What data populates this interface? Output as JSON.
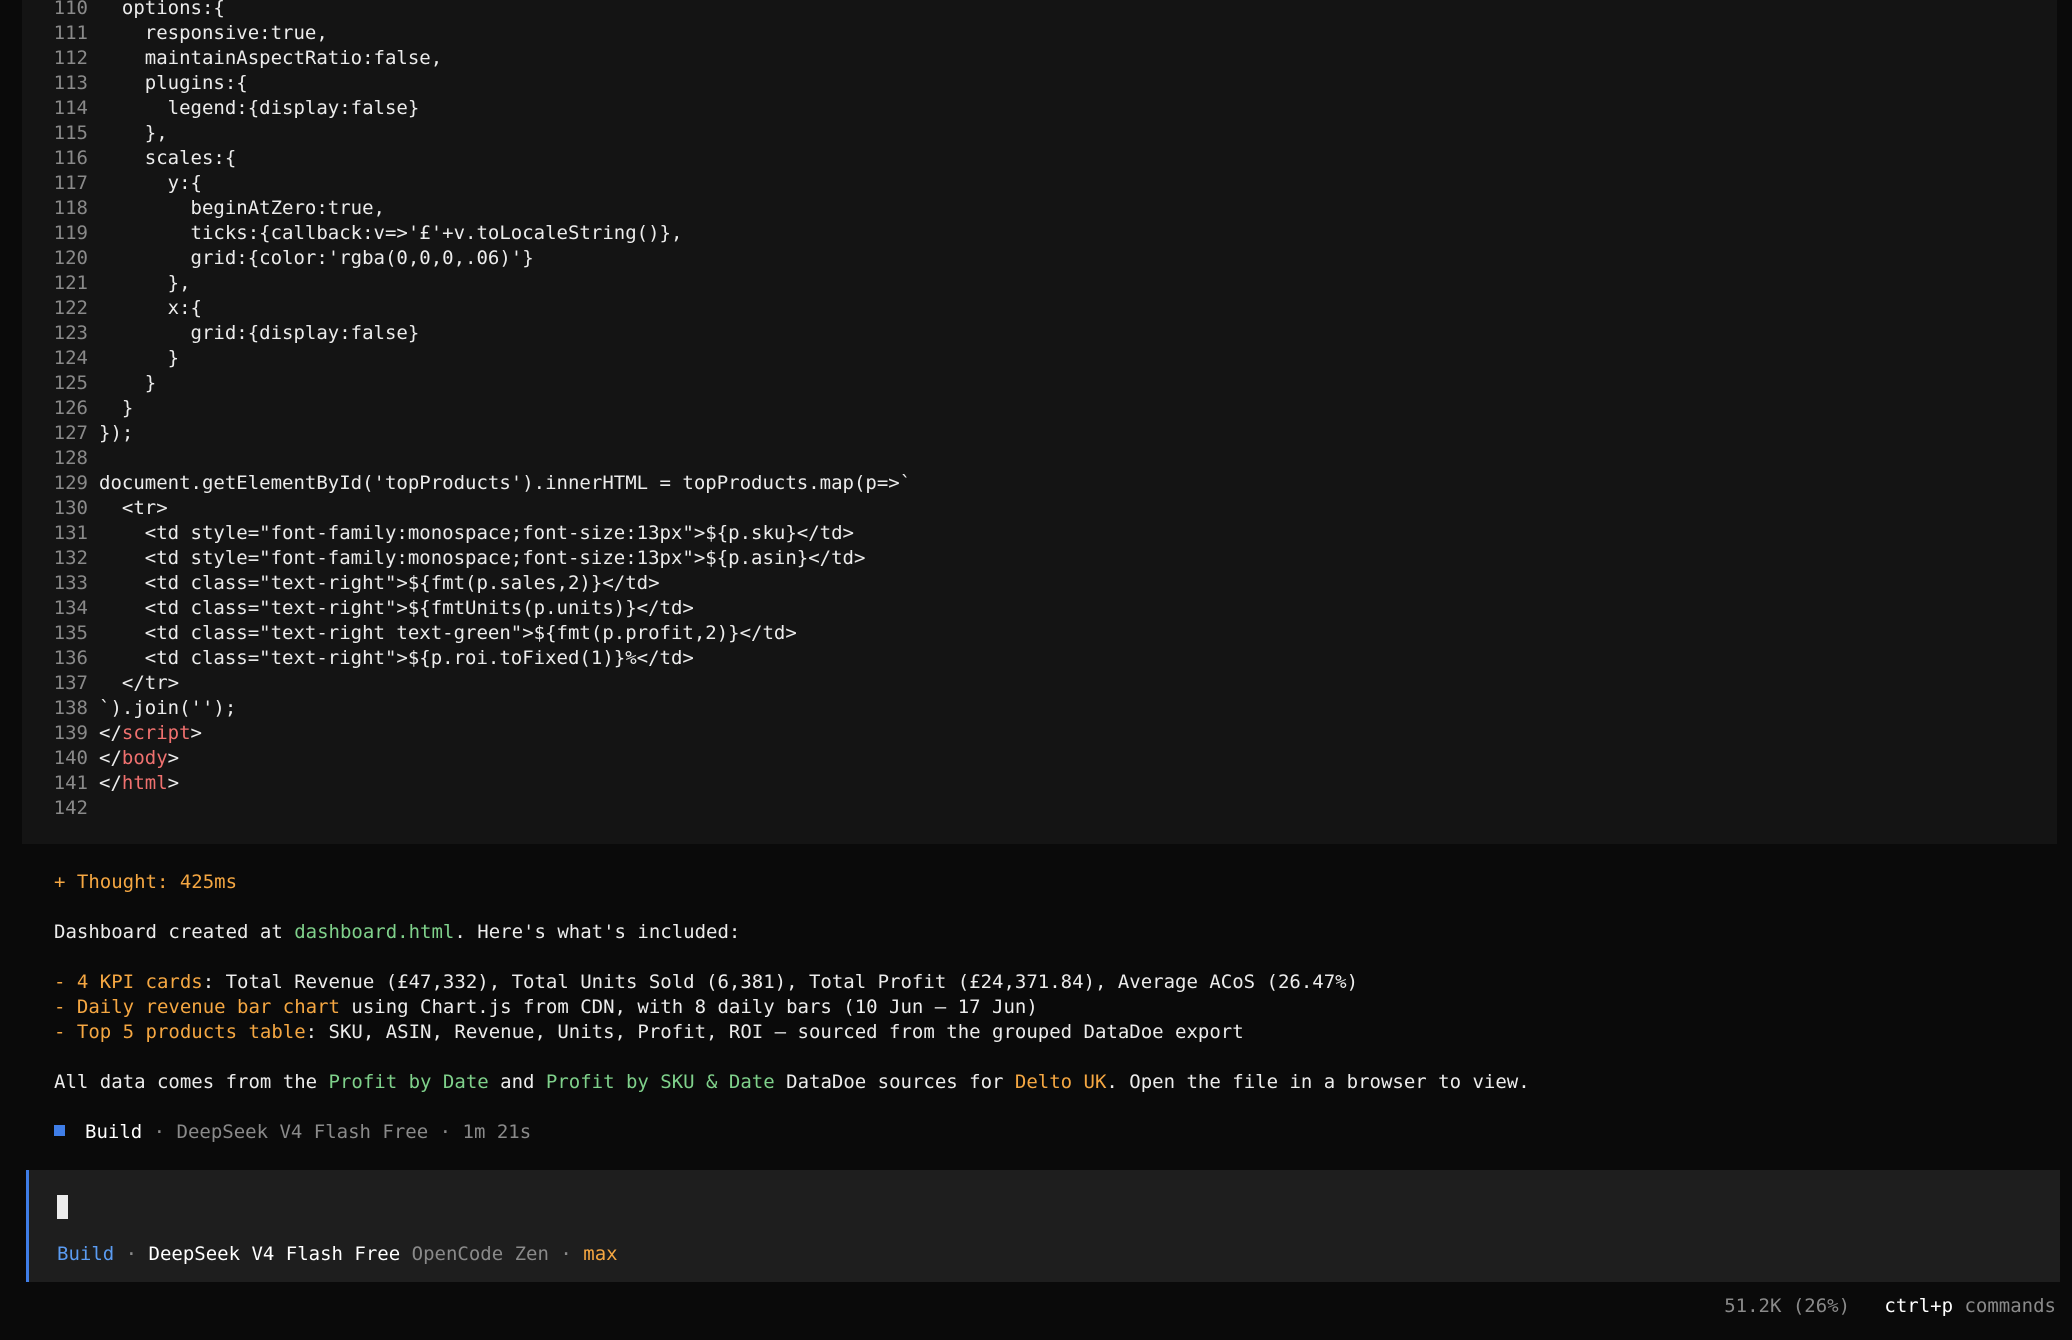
{
  "code": {
    "lines": [
      {
        "n": "110",
        "segs": [
          {
            "t": "  options:{"
          }
        ]
      },
      {
        "n": "111",
        "segs": [
          {
            "t": "    responsive:true,"
          }
        ]
      },
      {
        "n": "112",
        "segs": [
          {
            "t": "    maintainAspectRatio:false,"
          }
        ]
      },
      {
        "n": "113",
        "segs": [
          {
            "t": "    plugins:{"
          }
        ]
      },
      {
        "n": "114",
        "segs": [
          {
            "t": "      legend:{display:false}"
          }
        ]
      },
      {
        "n": "115",
        "segs": [
          {
            "t": "    },"
          }
        ]
      },
      {
        "n": "116",
        "segs": [
          {
            "t": "    scales:{"
          }
        ]
      },
      {
        "n": "117",
        "segs": [
          {
            "t": "      y:{"
          }
        ]
      },
      {
        "n": "118",
        "segs": [
          {
            "t": "        beginAtZero:true,"
          }
        ]
      },
      {
        "n": "119",
        "segs": [
          {
            "t": "        ticks:{callback:v=>'£'+v.toLocaleString()},"
          }
        ]
      },
      {
        "n": "120",
        "segs": [
          {
            "t": "        grid:{color:'rgba(0,0,0,.06)'}"
          }
        ]
      },
      {
        "n": "121",
        "segs": [
          {
            "t": "      },"
          }
        ]
      },
      {
        "n": "122",
        "segs": [
          {
            "t": "      x:{"
          }
        ]
      },
      {
        "n": "123",
        "segs": [
          {
            "t": "        grid:{display:false}"
          }
        ]
      },
      {
        "n": "124",
        "segs": [
          {
            "t": "      }"
          }
        ]
      },
      {
        "n": "125",
        "segs": [
          {
            "t": "    }"
          }
        ]
      },
      {
        "n": "126",
        "segs": [
          {
            "t": "  }"
          }
        ]
      },
      {
        "n": "127",
        "segs": [
          {
            "t": "});"
          }
        ]
      },
      {
        "n": "128",
        "segs": [
          {
            "t": ""
          }
        ]
      },
      {
        "n": "129",
        "segs": [
          {
            "t": "document.getElementById('topProducts').innerHTML = topProducts.map(p=>`"
          }
        ]
      },
      {
        "n": "130",
        "segs": [
          {
            "t": "  <tr>"
          }
        ]
      },
      {
        "n": "131",
        "segs": [
          {
            "t": "    <td style=\"font-family:monospace;font-size:13px\">${p.sku}</td>"
          }
        ]
      },
      {
        "n": "132",
        "segs": [
          {
            "t": "    <td style=\"font-family:monospace;font-size:13px\">${p.asin}</td>"
          }
        ]
      },
      {
        "n": "133",
        "segs": [
          {
            "t": "    <td class=\"text-right\">${fmt(p.sales,2)}</td>"
          }
        ]
      },
      {
        "n": "134",
        "segs": [
          {
            "t": "    <td class=\"text-right\">${fmtUnits(p.units)}</td>"
          }
        ]
      },
      {
        "n": "135",
        "segs": [
          {
            "t": "    <td class=\"text-right text-green\">${fmt(p.profit,2)}</td>"
          }
        ]
      },
      {
        "n": "136",
        "segs": [
          {
            "t": "    <td class=\"text-right\">${p.roi.toFixed(1)}%</td>"
          }
        ]
      },
      {
        "n": "137",
        "segs": [
          {
            "t": "  </tr>"
          }
        ]
      },
      {
        "n": "138",
        "segs": [
          {
            "t": "`).join('');"
          }
        ]
      },
      {
        "n": "139",
        "segs": [
          {
            "t": "</"
          },
          {
            "t": "script",
            "c": "tag"
          },
          {
            "t": ">"
          }
        ]
      },
      {
        "n": "140",
        "segs": [
          {
            "t": "</"
          },
          {
            "t": "body",
            "c": "tag"
          },
          {
            "t": ">"
          }
        ]
      },
      {
        "n": "141",
        "segs": [
          {
            "t": "</"
          },
          {
            "t": "html",
            "c": "tag"
          },
          {
            "t": ">"
          }
        ]
      },
      {
        "n": "142",
        "segs": [
          {
            "t": ""
          }
        ]
      }
    ]
  },
  "chat": {
    "thought": "+ Thought: 425ms",
    "summary": {
      "prefix": "Dashboard created at ",
      "file": "dashboard.html",
      "suffix": ". Here's what's included:"
    },
    "bullets": [
      {
        "label": "- 4 KPI cards",
        "text": ": Total Revenue (£47,332), Total Units Sold (6,381), Total Profit (£24,371.84), Average ACoS (26.47%)"
      },
      {
        "label": "- Daily revenue bar chart",
        "text": " using Chart.js from CDN, with 8 daily bars (10 Jun – 17 Jun)"
      },
      {
        "label": "- Top 5 products table",
        "text": ": SKU, ASIN, Revenue, Units, Profit, ROI — sourced from the grouped DataDoe export"
      }
    ],
    "sources": {
      "prefix": "All data comes from the ",
      "src1": "Profit by Date",
      "mid": " and ",
      "src2": "Profit by SKU & Date",
      "mid2": " DataDoe sources for ",
      "account": "Delto UK",
      "suffix": ". Open the file in a browser to view."
    },
    "build_meta": {
      "mode": "Build",
      "sep": " · ",
      "model": "DeepSeek V4 Flash Free",
      "duration": "1m 21s"
    }
  },
  "input": {
    "mode": "Build",
    "sep": " · ",
    "model": "DeepSeek V4 Flash Free",
    "provider": " OpenCode Zen",
    "variant": "max"
  },
  "footer": {
    "tokens": "51.2K (26%)",
    "shortcut": "ctrl+p",
    "commands": " commands"
  },
  "colors": {
    "accent_blue": "#3f7ee8",
    "orange": "#f5a742",
    "green": "#7fd18b",
    "tag_red": "#f0716f"
  }
}
